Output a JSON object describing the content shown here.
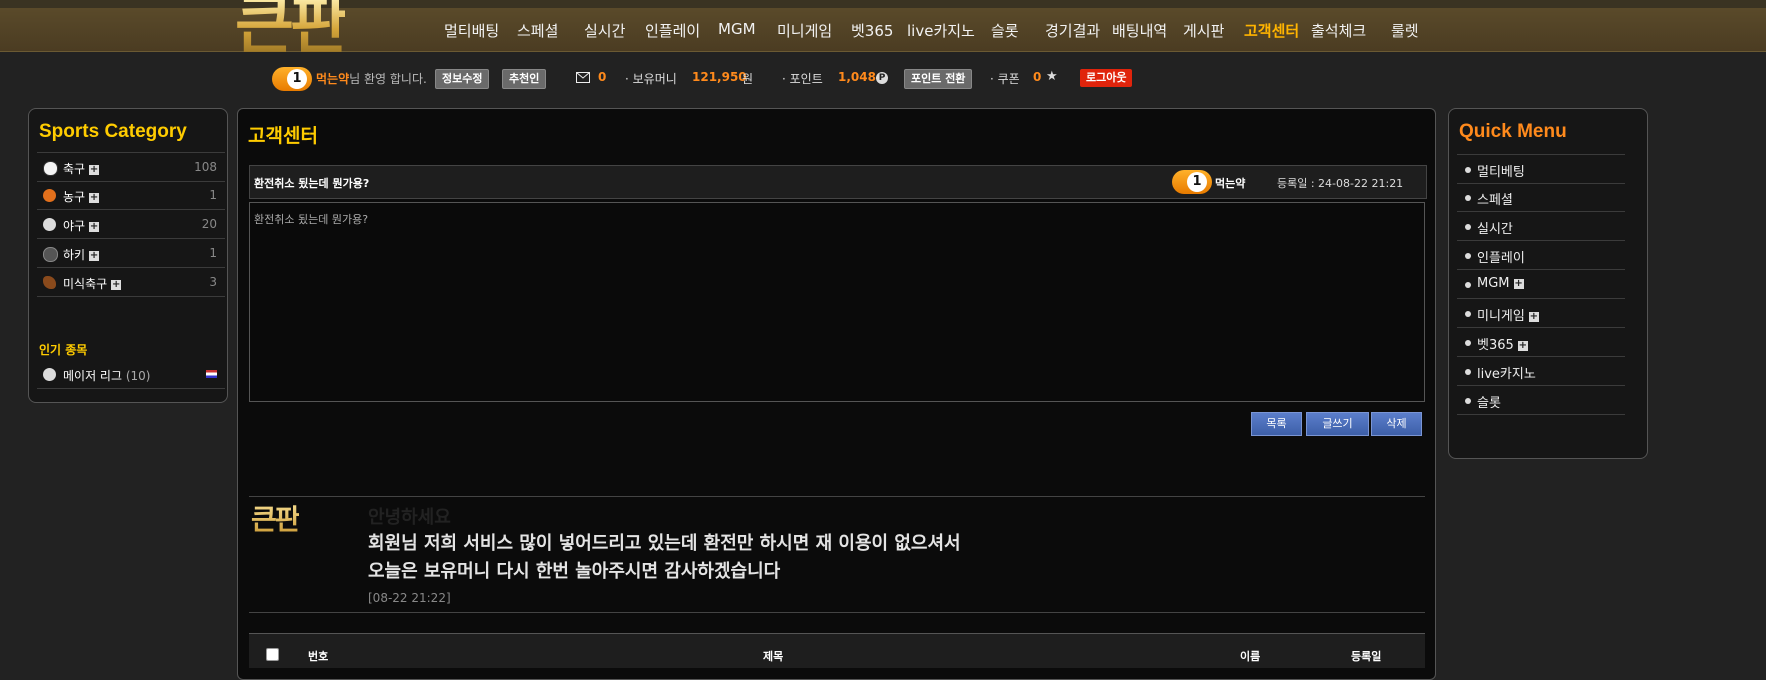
{
  "brand": {
    "logo_text": "큰판",
    "reply_logo_text": "큰판"
  },
  "nav": {
    "items": [
      "멀티배팅",
      "스페셜",
      "실시간",
      "인플레이",
      "MGM",
      "미니게임",
      "벳365",
      "live카지노",
      "슬롯",
      "경기결과",
      "배팅내역",
      "게시판",
      "고객센터",
      "출석체크",
      "룰렛"
    ],
    "active": "고객센터"
  },
  "user": {
    "level": "1",
    "nickname": "먹는약",
    "greeting": "님 환영 합니다.",
    "edit_info": "정보수정",
    "recommender": "추천인",
    "messages": "0",
    "money_label": "· 보유머니",
    "money_value": "121,950",
    "money_unit": "원",
    "point_label": "· 포인트",
    "point_value": "1,048",
    "point_icon": "P",
    "point_convert": "포인트 전환",
    "coupon_label": "· 쿠폰",
    "coupon_value": "0",
    "logout": "로그아웃"
  },
  "sports": {
    "title": "Sports Category",
    "items": [
      {
        "label": "축구",
        "count": "108",
        "color": "#f4f4f4"
      },
      {
        "label": "농구",
        "count": "1",
        "color": "#e2701c"
      },
      {
        "label": "야구",
        "count": "20",
        "color": "#dcdcdc"
      },
      {
        "label": "하키",
        "count": "1",
        "color": "#555555"
      },
      {
        "label": "미식축구",
        "count": "3",
        "color": "#8a4a1c"
      }
    ],
    "popular_title": "인기 종목",
    "popular": [
      {
        "label": "메이저 리그",
        "count": "(10)"
      }
    ]
  },
  "quick": {
    "title": "Quick Menu",
    "items": [
      {
        "label": "멀티베팅",
        "plus": false
      },
      {
        "label": "스페셜",
        "plus": false
      },
      {
        "label": "실시간",
        "plus": false
      },
      {
        "label": "인플레이",
        "plus": false
      },
      {
        "label": "MGM",
        "plus": true
      },
      {
        "label": "미니게임",
        "plus": true
      },
      {
        "label": "벳365",
        "plus": true
      },
      {
        "label": "live카지노",
        "plus": false
      },
      {
        "label": "슬롯",
        "plus": false
      }
    ]
  },
  "main": {
    "title": "고객센터",
    "post": {
      "subject": "환전취소 됬는데 뭔가용?",
      "author_level": "1",
      "author": "먹는약",
      "date_label": "등록일 : 24-08-22 21:21",
      "body": "환전취소 됬는데 뭔가용?"
    },
    "buttons": {
      "list": "목록",
      "write": "글쓰기",
      "delete": "삭제"
    },
    "reply": {
      "line0": "안녕하세요",
      "line1": "회원님 저희 서비스 많이 넣어드리고 있는데 환전만 하시면 재 이용이 없으셔서",
      "line2": "오늘은 보유머니 다시 한번 놀아주시면 감사하겠습니다",
      "date": "[08-22 21:22]"
    },
    "list_headers": {
      "no": "번호",
      "subject": "제목",
      "name": "이름",
      "date": "등록일"
    }
  },
  "colors": {
    "accent": "#ffcc00",
    "orange": "#ff8a1c",
    "logout": "#e0240c",
    "button_blue": "#4a6cb8"
  }
}
